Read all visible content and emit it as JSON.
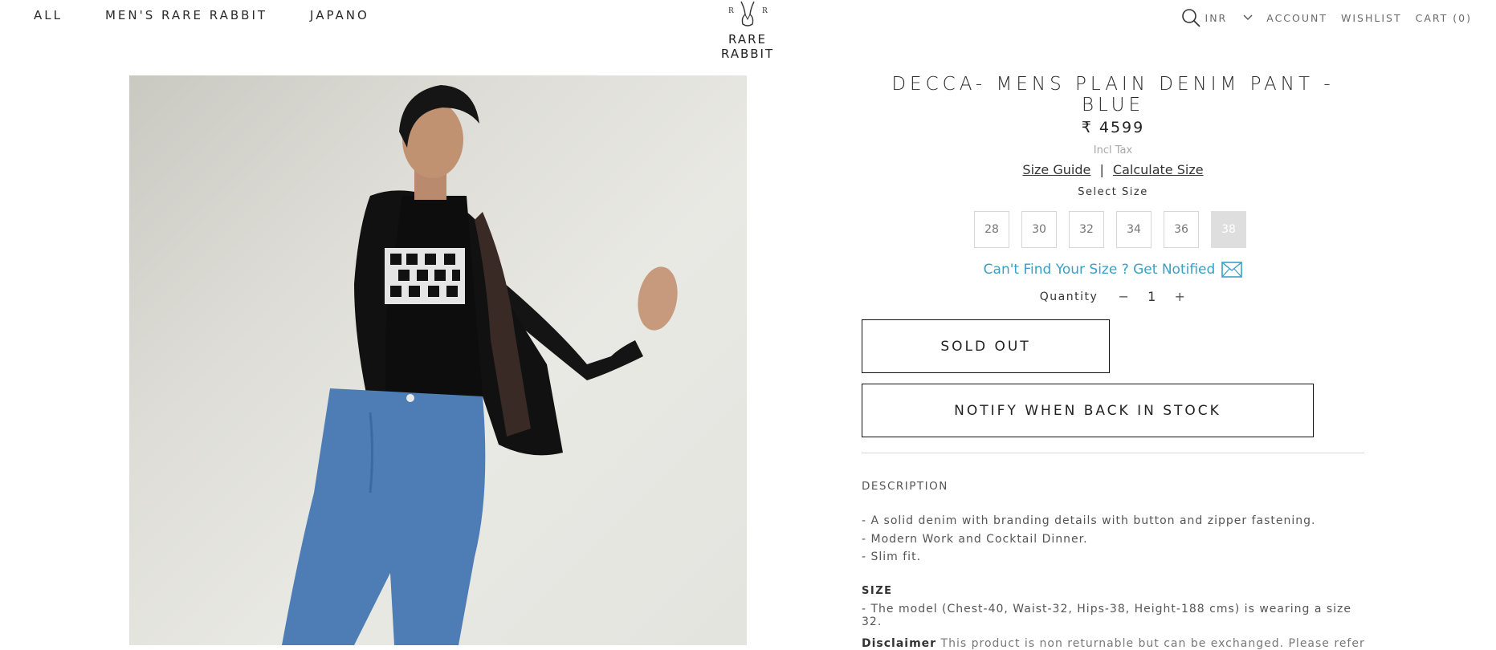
{
  "nav": {
    "left": [
      "ALL",
      "MEN'S RARE RABBIT",
      "JAPANO"
    ],
    "brand": "RARE RABBIT",
    "logo_letters": [
      "R",
      "R"
    ],
    "currency": "INR",
    "account": "ACCOUNT",
    "wishlist": "WISHLIST",
    "cart": "CART (0)"
  },
  "product": {
    "title": "DECCA- MENS PLAIN DENIM PANT - BLUE",
    "price": "₹ 4599",
    "tax_note": "Incl Tax",
    "size_guide": "Size Guide",
    "separator": "|",
    "calculate_size": "Calculate Size",
    "select_size": "Select Size",
    "sizes": [
      {
        "label": "28",
        "available": true
      },
      {
        "label": "30",
        "available": true
      },
      {
        "label": "32",
        "available": true
      },
      {
        "label": "34",
        "available": true
      },
      {
        "label": "36",
        "available": true
      },
      {
        "label": "38",
        "available": false
      }
    ],
    "notify_size": "Can't Find Your Size ? Get Notified",
    "quantity_label": "Quantity",
    "quantity": "1",
    "minus": "−",
    "plus": "+",
    "sold_out": "SOLD OUT",
    "notify_stock": "NOTIFY WHEN BACK IN STOCK",
    "description_heading": "DESCRIPTION",
    "description_items": [
      "- A solid denim with branding details with button and zipper fastening.",
      "- Modern Work and Cocktail Dinner.",
      "- Slim fit."
    ],
    "size_heading": "SIZE",
    "size_text": "- The model (Chest-40, Waist-32, Hips-38, Height-188 cms) is wearing a size 32.",
    "disclaimer_label": "Disclaimer",
    "disclaimer_text": "This product is non returnable but can be exchanged. Please refer"
  },
  "colors": {
    "accent_link": "#3aa0c6",
    "unavailable_size_bg": "#dedede"
  },
  "icons": {
    "search": "search-icon",
    "currency_toggle": "chevron-down-icon",
    "notify": "envelope-icon"
  }
}
